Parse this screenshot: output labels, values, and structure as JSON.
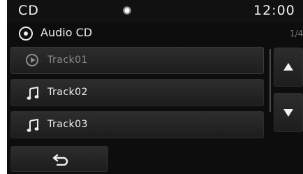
{
  "status_bar": {
    "title": "CD",
    "clock": "12:00"
  },
  "source": {
    "name": "Audio CD",
    "page": "1/4",
    "icon": "disc-icon"
  },
  "tracks": [
    {
      "label": "Track01",
      "icon": "play-icon",
      "state": "playing"
    },
    {
      "label": "Track02",
      "icon": "music-note-icon"
    },
    {
      "label": "Track03",
      "icon": "music-note-icon"
    }
  ],
  "controls": {
    "scroll_up_icon": "arrow-up-icon",
    "scroll_down_icon": "arrow-down-icon",
    "back_icon": "back-arrow-icon"
  },
  "colors": {
    "background": "#0d0d0d",
    "button": "#262626",
    "text": "#f0f0f0",
    "dim_text": "#8a8a8a"
  }
}
